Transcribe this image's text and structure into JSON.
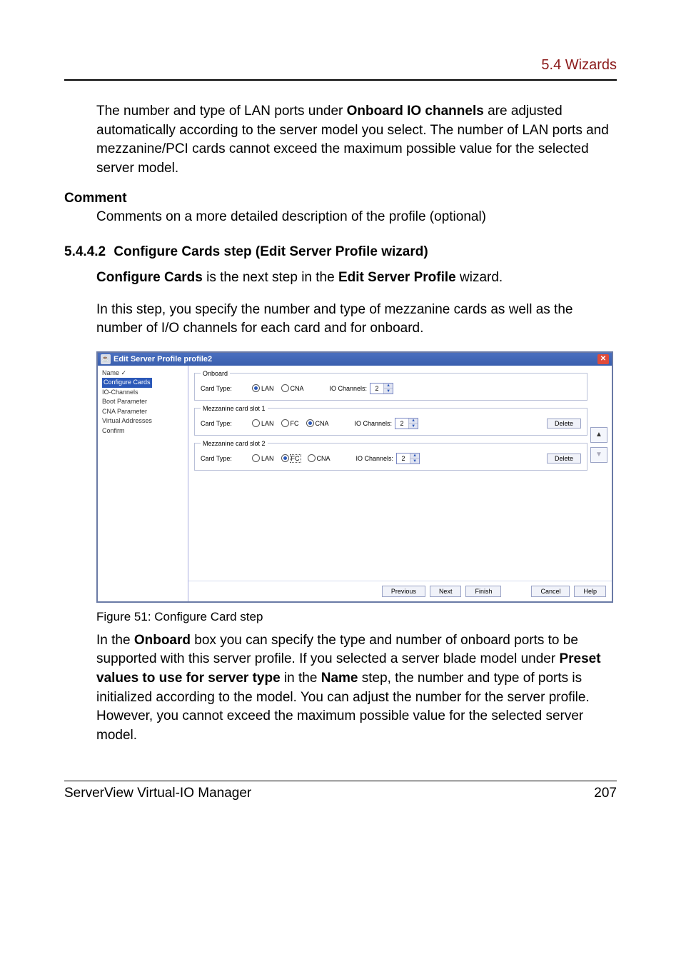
{
  "header": {
    "section": "5.4 Wizards"
  },
  "para1": {
    "pre": "The number and type of LAN ports under ",
    "bold1": "Onboard IO channels",
    "post": " are adjusted automatically according to the server model you select. The number of LAN ports and mezzanine/PCI cards cannot exceed the maximum possible value for the selected server model."
  },
  "comment": {
    "title": "Comment",
    "body": "Comments on a more detailed description of the profile (optional)"
  },
  "section": {
    "num": "5.4.4.2",
    "title": "Configure Cards step (Edit Server Profile wizard)"
  },
  "intro": {
    "pre": "",
    "b1": "Configure Cards",
    "mid": " is the next step in the ",
    "b2": "Edit Server Profile",
    "post": " wizard."
  },
  "para2": "In this step, you specify the number and type of mezzanine cards as well as the number of I/O channels for each card and for onboard.",
  "dialog": {
    "title": "Edit Server Profile profile2",
    "nav": {
      "name": "Name",
      "configure_cards": "Configure Cards",
      "io_channels": "IO-Channels",
      "boot_param": "Boot Parameter",
      "cna_param": "CNA Parameter",
      "virt_addr": "Virtual Addresses",
      "confirm": "Confirm"
    },
    "labels": {
      "onboard_legend": "Onboard",
      "card_type": "Card Type:",
      "io_channels": "IO Channels:",
      "lan": "LAN",
      "fc": "FC",
      "cna": "CNA",
      "mezz1_legend": "Mezzanine card slot 1",
      "mezz2_legend": "Mezzanine card slot 2",
      "delete": "Delete"
    },
    "values": {
      "onboard_channels": "2",
      "mezz1_channels": "2",
      "mezz2_channels": "2"
    },
    "buttons": {
      "previous": "Previous",
      "next": "Next",
      "finish": "Finish",
      "cancel": "Cancel",
      "help": "Help"
    }
  },
  "figure_caption": "Figure 51: Configure Card step",
  "para3": {
    "t1": "In the ",
    "b1": "Onboard",
    "t2": " box you can specify the type and number of onboard ports to be supported with this server profile. If you selected a server blade model under ",
    "b2": "Preset values to use for server type",
    "t3": " in the ",
    "b3": "Name",
    "t4": " step, the number and type of ports is initialized according to the model. You can adjust the number for the server profile. However, you cannot exceed the maximum possible value for the selected server model."
  },
  "footer": {
    "left": "ServerView Virtual-IO Manager",
    "right": "207"
  }
}
